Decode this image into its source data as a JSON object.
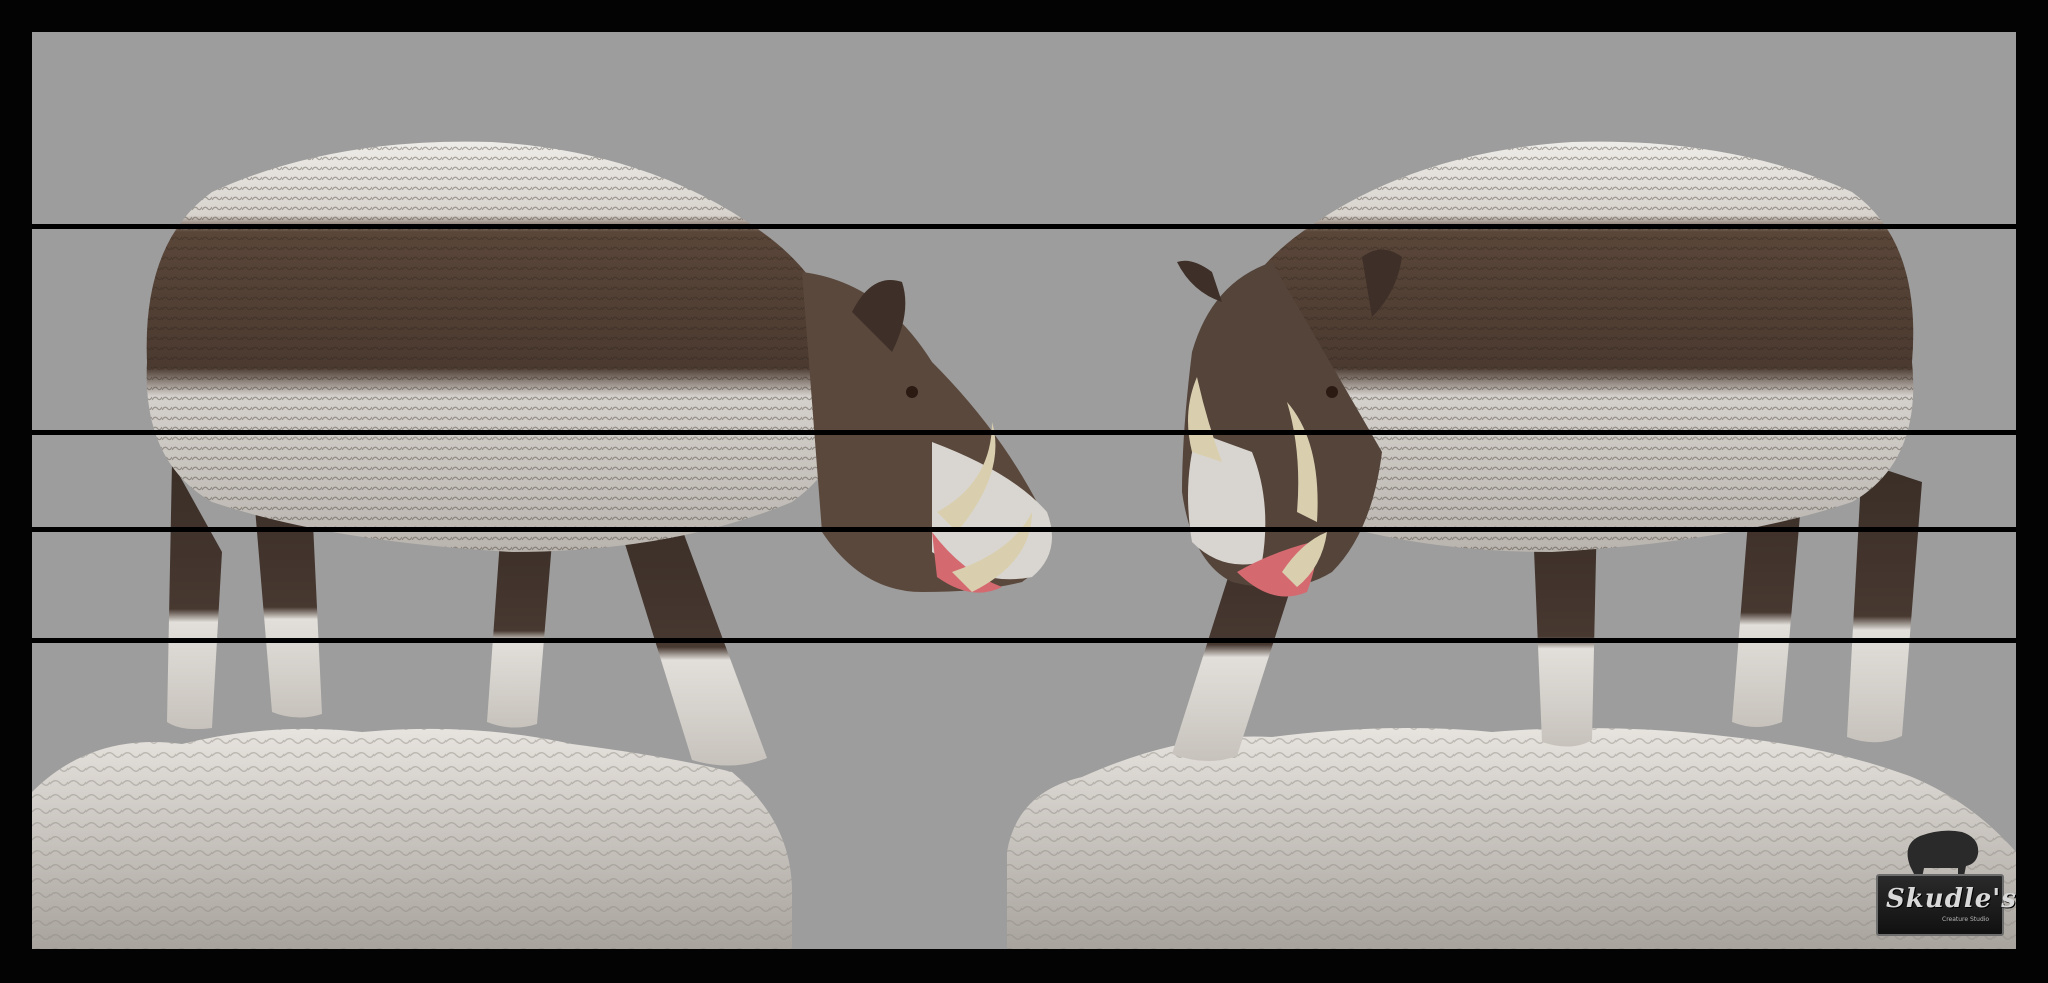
{
  "image": {
    "description_type": "3d-sculpt-render",
    "subjects": [
      "boar-left",
      "boar-right"
    ],
    "colors": {
      "background": "#9d9d9d",
      "frame": "#030303",
      "reference_line": "#000000",
      "rock": "#d8d4cf",
      "fur_dark": "#4a3b31",
      "fur_light": "#e6e4e0",
      "tusk": "#d9cfaf",
      "mouth": "#d46a70"
    }
  },
  "logo": {
    "text": "Skudle's",
    "subtitle": "Creature Studio"
  }
}
